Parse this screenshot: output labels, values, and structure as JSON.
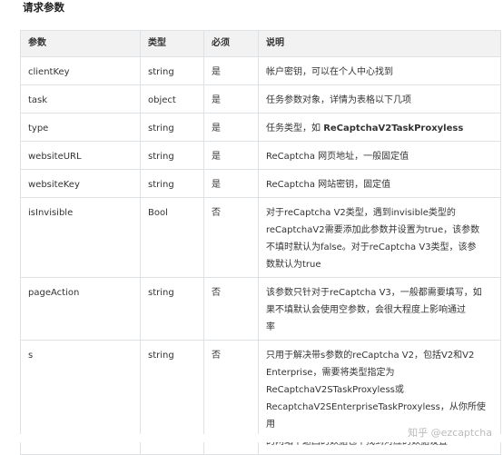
{
  "section_title": "请求参数",
  "table": {
    "headers": [
      "参数",
      "类型",
      "必须",
      "说明"
    ],
    "rows": [
      {
        "param": "clientKey",
        "type": "string",
        "required": "是",
        "desc": "帐户密钥，可以在个人中心找到"
      },
      {
        "param": "task",
        "type": "object",
        "required": "是",
        "desc": "任务参数对象，详情为表格以下几项"
      },
      {
        "param": "type",
        "type": "string",
        "required": "是",
        "desc_prefix": "任务类型，如 ",
        "desc_bold": "ReCaptchaV2TaskProxyless"
      },
      {
        "param": "websiteURL",
        "type": "string",
        "required": "是",
        "desc": "ReCaptcha 网页地址，一般固定值"
      },
      {
        "param": "websiteKey",
        "type": "string",
        "required": "是",
        "desc": "ReCaptcha 网站密钥，固定值"
      },
      {
        "param": "isInvisible",
        "type": "Bool",
        "required": "否",
        "desc_lines": [
          "对于reCaptcha V2类型，遇到invisible类型的",
          "reCaptchaV2需要添加此参数并设置为true，该参数",
          "不填时默认为false。对于reCaptcha V3类型，该参",
          "数默认为true"
        ]
      },
      {
        "param": "pageAction",
        "type": "string",
        "required": "否",
        "desc_lines": [
          "该参数只针对于reCaptcha V3，一般都需要填写，如",
          "果不填默认会使用空参数，会很大程度上影响通过",
          "率"
        ]
      },
      {
        "param": "s",
        "type": "string",
        "required": "否",
        "desc_lines": [
          "只用于解决带s参数的reCaptcha V2，包括V2和V2",
          "Enterprise，需要将类型指定为",
          "ReCaptchaV2STaskProxyless或",
          "RecaptchaV2SEnterpriseTaskProxyless，从你所使用",
          "的网站中返回的数据包中找到对应的数据设置"
        ]
      }
    ]
  },
  "watermark": "知乎 @ezcaptcha"
}
